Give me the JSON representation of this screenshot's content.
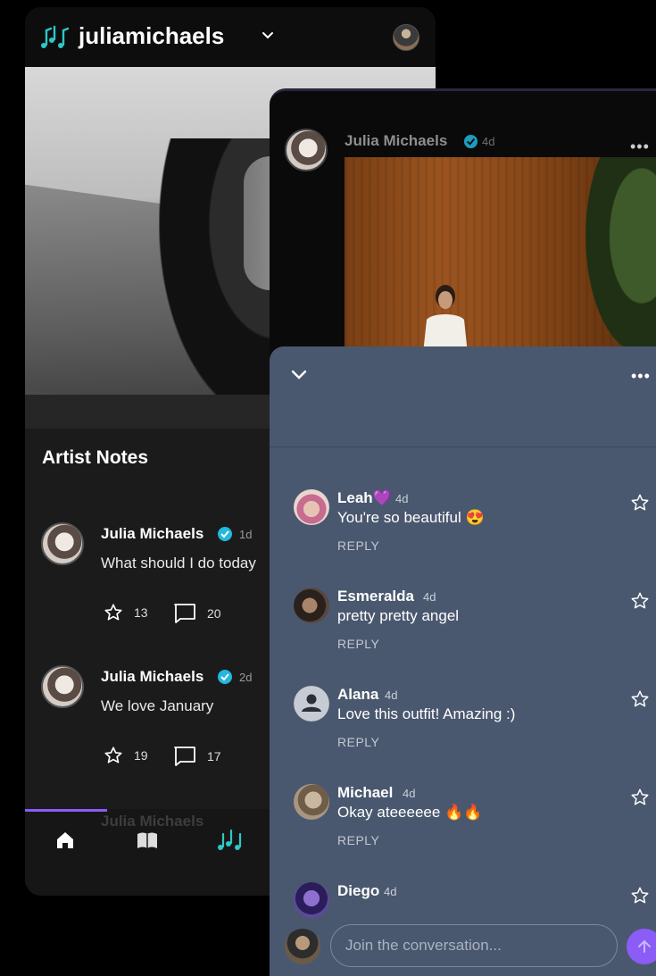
{
  "header": {
    "brand_name": "juliamichaels"
  },
  "notes": {
    "title": "Artist Notes",
    "items": [
      {
        "name": "Julia Michaels",
        "time": "1d",
        "text": "What should I do today",
        "likes": "13",
        "comments": "20"
      },
      {
        "name": "Julia Michaels",
        "time": "2d",
        "text": "We love January",
        "likes": "19",
        "comments": "17"
      }
    ],
    "ghost_name": "Julia Michaels"
  },
  "post": {
    "name": "Julia Michaels",
    "time": "4d",
    "more": "•••"
  },
  "sheet": {
    "more": "•••",
    "comments": [
      {
        "name": "Leah💜",
        "time": "4d",
        "text": "You're so beautiful 😍",
        "reply": "REPLY"
      },
      {
        "name": "Esmeralda",
        "time": "4d",
        "text": "pretty pretty angel",
        "reply": "REPLY"
      },
      {
        "name": "Alana",
        "time": "4d",
        "text": "Love this outfit! Amazing :)",
        "reply": "REPLY"
      },
      {
        "name": "Michael",
        "time": "4d",
        "text": "Okay ateeeeee 🔥🔥",
        "reply": "REPLY"
      },
      {
        "name": "Diego",
        "time": "4d",
        "text": "",
        "reply": ""
      }
    ],
    "input_placeholder": "Join the conversation..."
  },
  "colors": {
    "accent": "#8b5cf6",
    "verified": "#22b8e0",
    "brand_teal": "#2fc7c7",
    "sheet_bg": "#4a586f"
  },
  "icons": [
    "music-notes-icon",
    "chevron-down-icon",
    "verified-icon",
    "star-icon",
    "comment-icon",
    "home-icon",
    "book-icon",
    "send-icon",
    "more-icon"
  ]
}
